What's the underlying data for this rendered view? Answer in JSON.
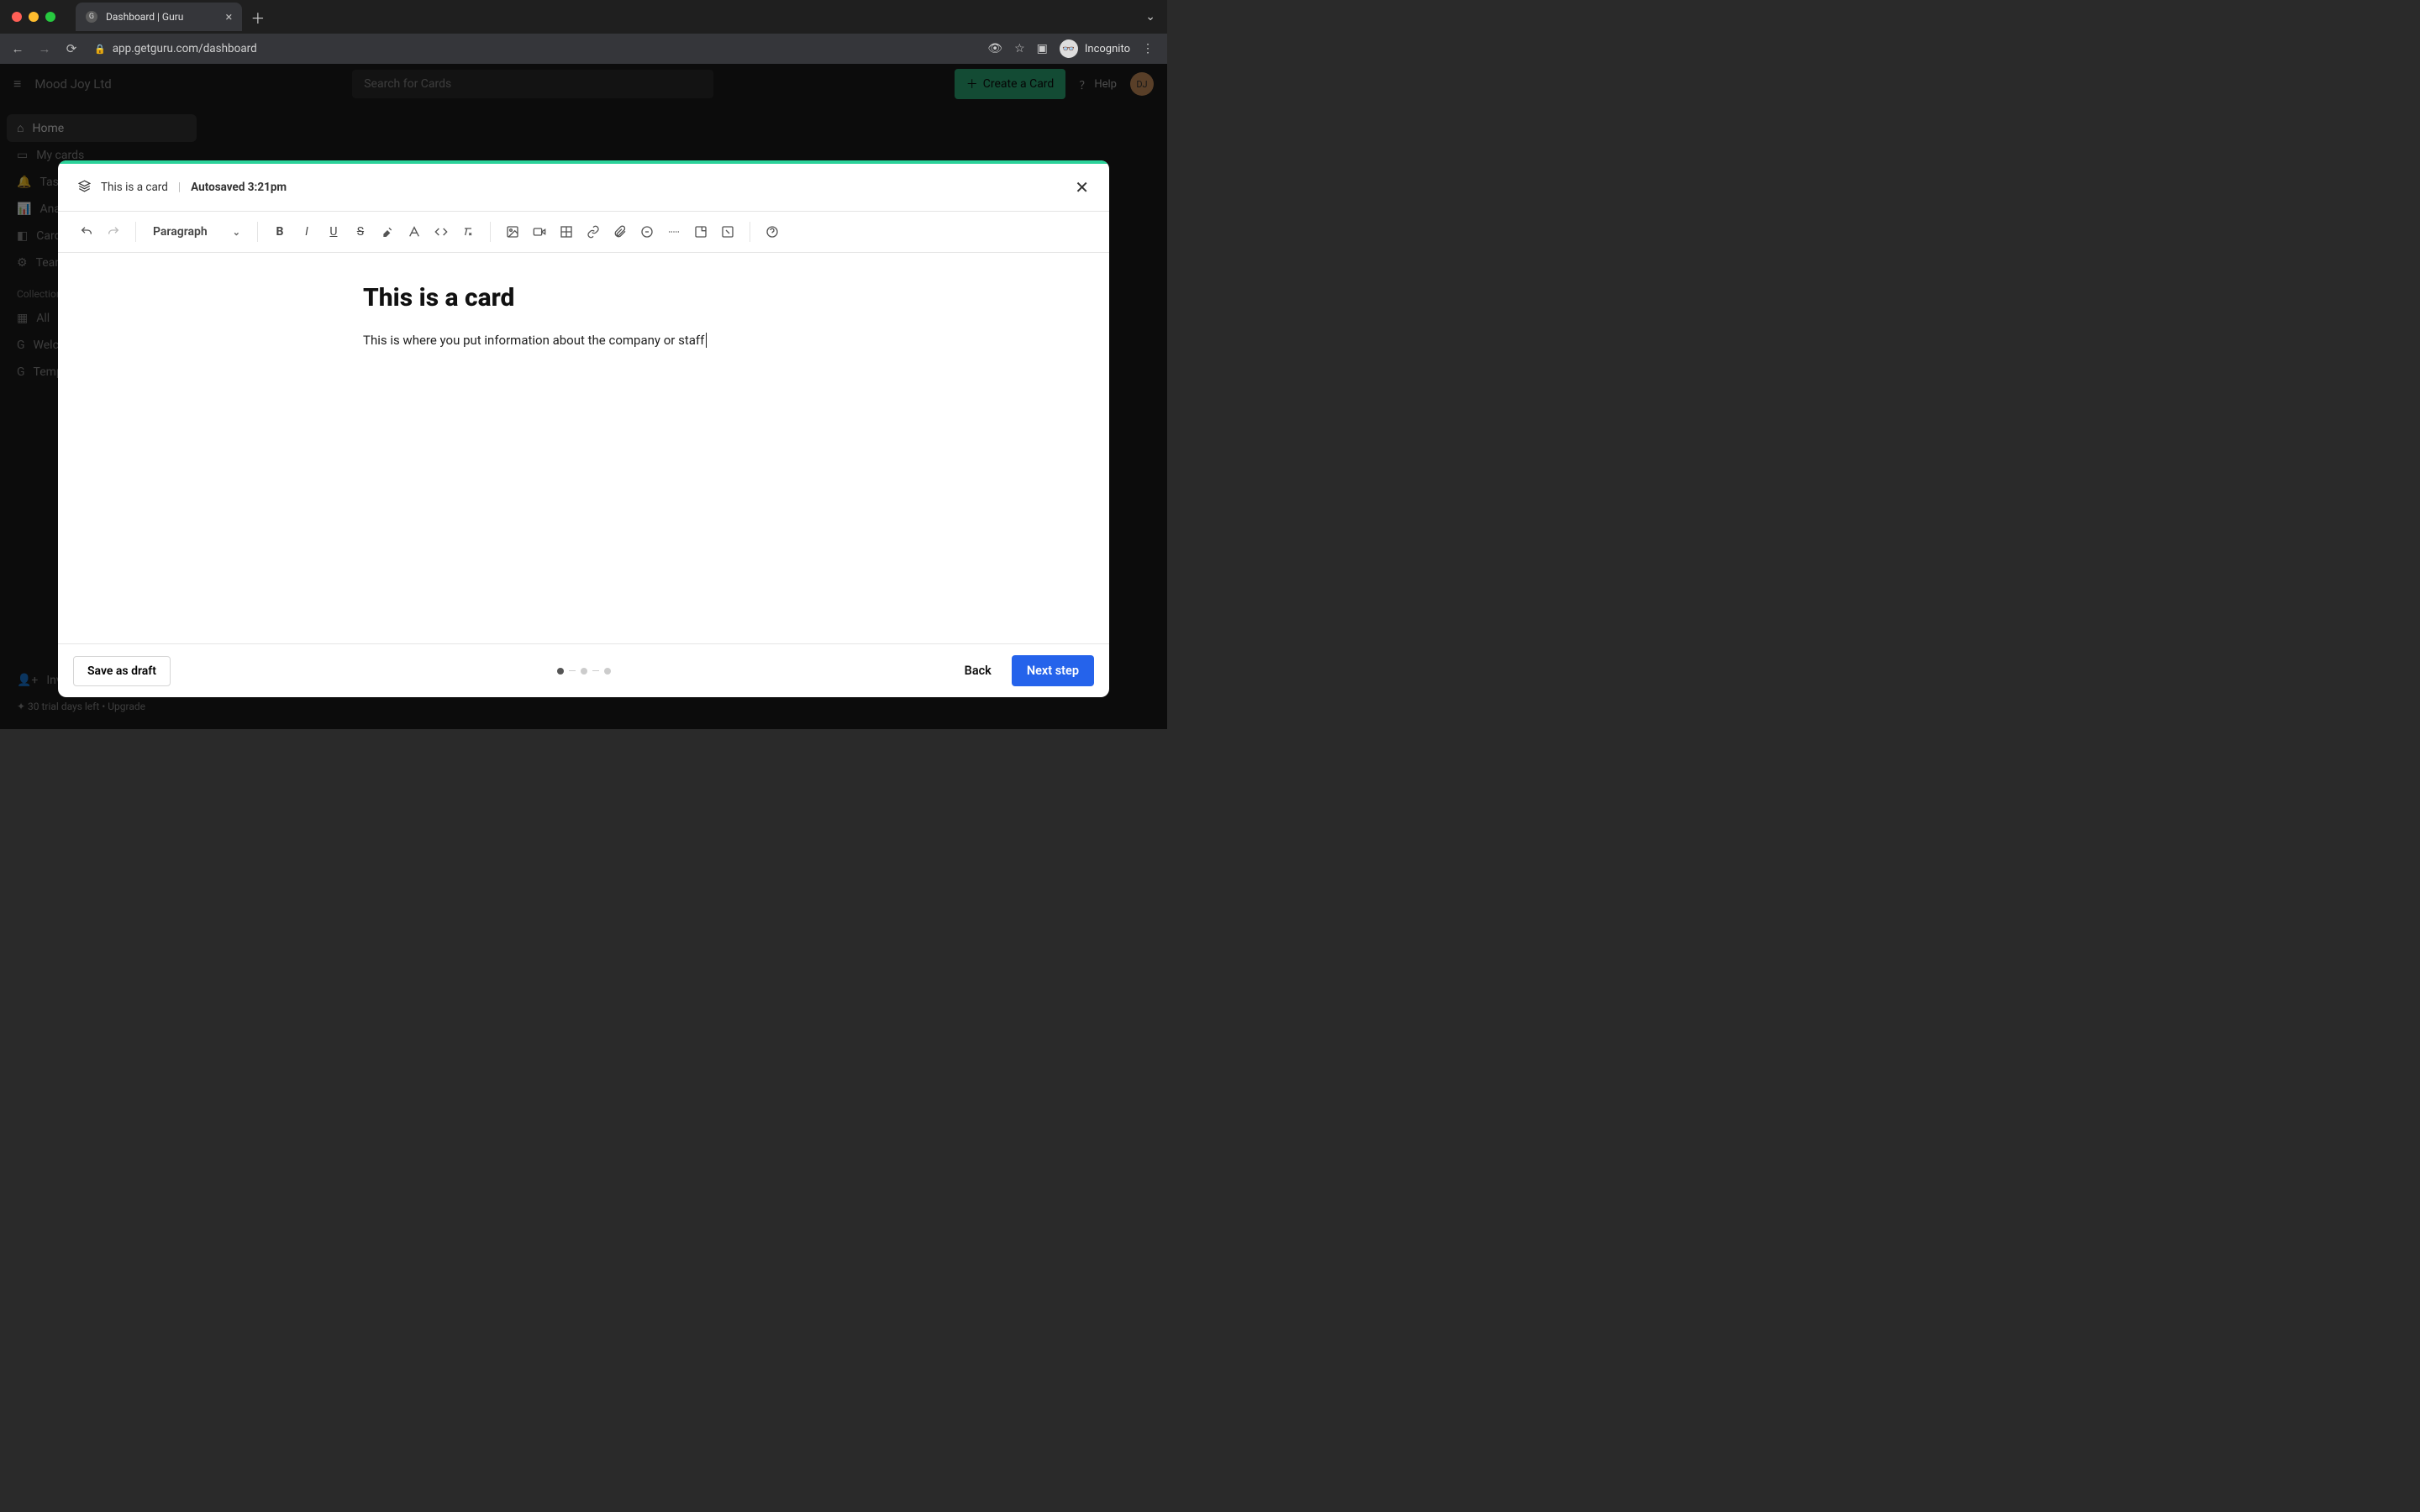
{
  "browser": {
    "tab_title": "Dashboard | Guru",
    "url": "app.getguru.com/dashboard",
    "incognito_label": "Incognito"
  },
  "app": {
    "org_name": "Mood Joy Ltd",
    "search_placeholder": "Search for Cards",
    "create_card_label": "Create a Card",
    "help_label": "Help",
    "avatar_initials": "DJ"
  },
  "sidebar": {
    "items": [
      {
        "icon": "home",
        "label": "Home"
      },
      {
        "icon": "cards",
        "label": "My cards"
      },
      {
        "icon": "bell",
        "label": "Tasks"
      },
      {
        "icon": "analytics",
        "label": "Analytics"
      },
      {
        "icon": "folder",
        "label": "Cards"
      },
      {
        "icon": "gear",
        "label": "Team"
      }
    ],
    "section_label": "Collections",
    "collections": [
      {
        "label": "All"
      },
      {
        "label": "Welcome"
      },
      {
        "label": "Templates"
      }
    ],
    "invite_label": "Invite",
    "trial_text": "30 trial days left • Upgrade"
  },
  "modal": {
    "breadcrumb_card": "This is a card",
    "autosaved_prefix": "Autosaved",
    "autosaved_time": "3:21pm",
    "style_select": "Paragraph",
    "title": "This is a card",
    "body_text": "This is where you put information about the company or staff",
    "save_draft_label": "Save as draft",
    "back_label": "Back",
    "next_label": "Next step"
  }
}
